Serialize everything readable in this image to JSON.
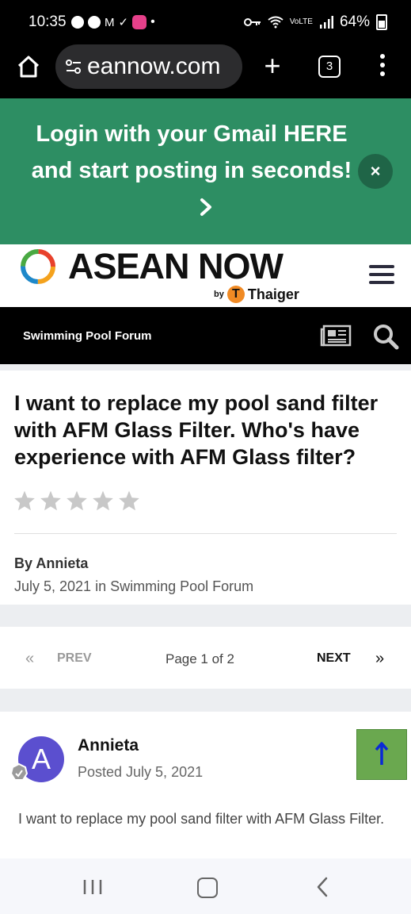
{
  "status_bar": {
    "time": "10:35",
    "network": "VoLTE",
    "battery": "64%",
    "icons": [
      "account-icon",
      "account-icon",
      "gmail-icon",
      "check-icon",
      "app-icon",
      "dot-icon",
      "key-icon",
      "wifi-icon",
      "signal-icon",
      "battery-icon"
    ]
  },
  "address_bar": {
    "url": "eannow.com",
    "tab_count": "3"
  },
  "banner": {
    "line1": "Login with your Gmail HERE",
    "line2": "and start posting in seconds!",
    "close_label": "×",
    "color": "#2d8e63"
  },
  "brand": {
    "logo_text": "ASEAN NOW",
    "by": "by",
    "partner_initial": "T",
    "partner": "Thaiger"
  },
  "nav": {
    "forum_title": "Swimming Pool Forum"
  },
  "topic": {
    "title": "I want to replace my pool sand filter with AFM Glass Filter. Who's have experience with AFM Glass filter?",
    "rating": 0,
    "rating_max": 5,
    "author_line": "By Annieta",
    "date_line": "July 5, 2021 in Swimming Pool Forum"
  },
  "pager": {
    "prev_arrow": "«",
    "prev": "PREV",
    "page": "Page 1 of 2",
    "next": "NEXT",
    "next_arrow": "»"
  },
  "post": {
    "avatar_initial": "A",
    "author": "Annieta",
    "date": "Posted July 5, 2021",
    "body": "I want to replace my pool sand filter with AFM Glass Filter."
  },
  "scroll_top": {
    "arrow": "↑",
    "color": "#6aa84f"
  }
}
